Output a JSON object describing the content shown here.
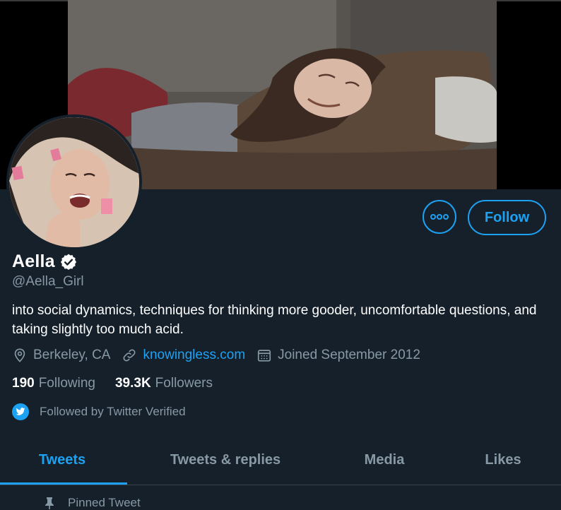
{
  "profile": {
    "name": "Aella",
    "handle": "@Aella_Girl",
    "bio": "into social dynamics, techniques for thinking more gooder, uncomfortable questions, and taking slightly too much acid.",
    "location": "Berkeley, CA",
    "website": "knowingless.com",
    "joined": "Joined September 2012"
  },
  "stats": {
    "following_count": "190",
    "following_label": "Following",
    "followers_count": "39.3K",
    "followers_label": "Followers"
  },
  "followed_by": "Followed by Twitter Verified",
  "actions": {
    "follow_label": "Follow",
    "more_icon": "more-horizontal-icon"
  },
  "tabs": [
    {
      "label": "Tweets",
      "active": true
    },
    {
      "label": "Tweets & replies",
      "active": false
    },
    {
      "label": "Media",
      "active": false
    },
    {
      "label": "Likes",
      "active": false
    }
  ],
  "pinned": {
    "label": "Pinned Tweet"
  },
  "colors": {
    "background": "#15202b",
    "accent": "#1da1f2",
    "muted_text": "#8899a6",
    "divider": "#38444d"
  }
}
